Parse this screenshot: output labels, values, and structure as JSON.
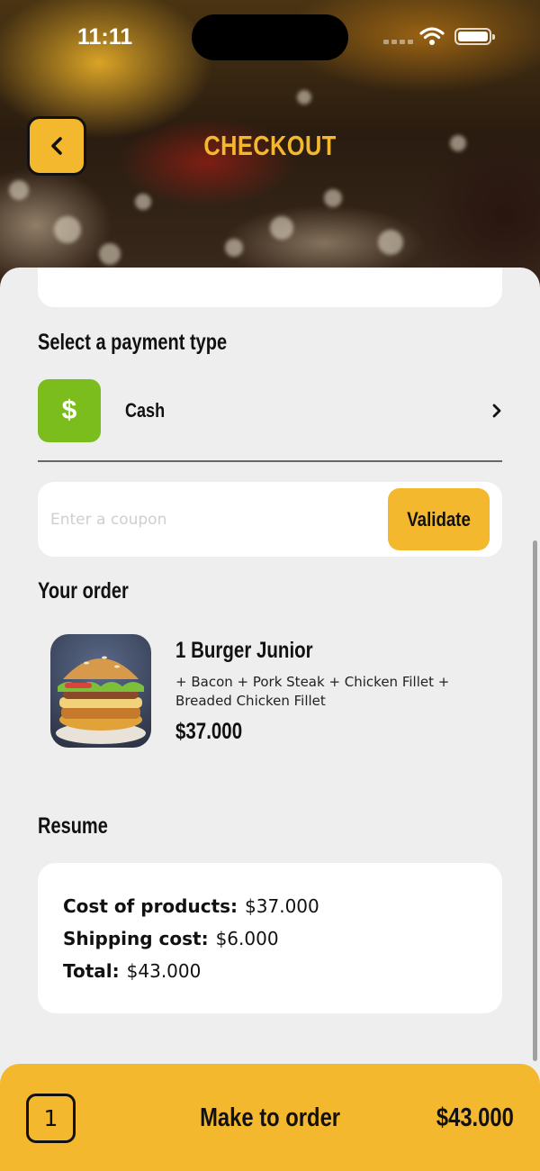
{
  "status_bar": {
    "time": "11:11"
  },
  "header": {
    "title": "CHECKOUT"
  },
  "payment": {
    "title": "Select a payment type",
    "method_symbol": "$",
    "method_label": "Cash",
    "method_color": "#7cbd1e"
  },
  "coupon": {
    "placeholder": "Enter a coupon",
    "value": "",
    "button_label": "Validate"
  },
  "order": {
    "title": "Your order",
    "item": {
      "name": "1 Burger Junior",
      "extras": "+ Bacon + Pork Steak + Chicken Fillet + Breaded Chicken Fillet",
      "price": "$37.000"
    }
  },
  "resume": {
    "title": "Resume",
    "lines": [
      {
        "label": "Cost of products:",
        "value": "$37.000"
      },
      {
        "label": "Shipping cost:",
        "value": "$6.000"
      },
      {
        "label": "Total:",
        "value": "$43.000"
      }
    ]
  },
  "footer": {
    "quantity": "1",
    "action_label": "Make to order",
    "total": "$43.000"
  },
  "colors": {
    "accent": "#f4b82e",
    "background": "#eeeeee",
    "cash": "#7cbd1e"
  },
  "icons": [
    "back-arrow-icon",
    "wifi-icon",
    "battery-icon",
    "dollar-icon",
    "chevron-right-icon"
  ]
}
